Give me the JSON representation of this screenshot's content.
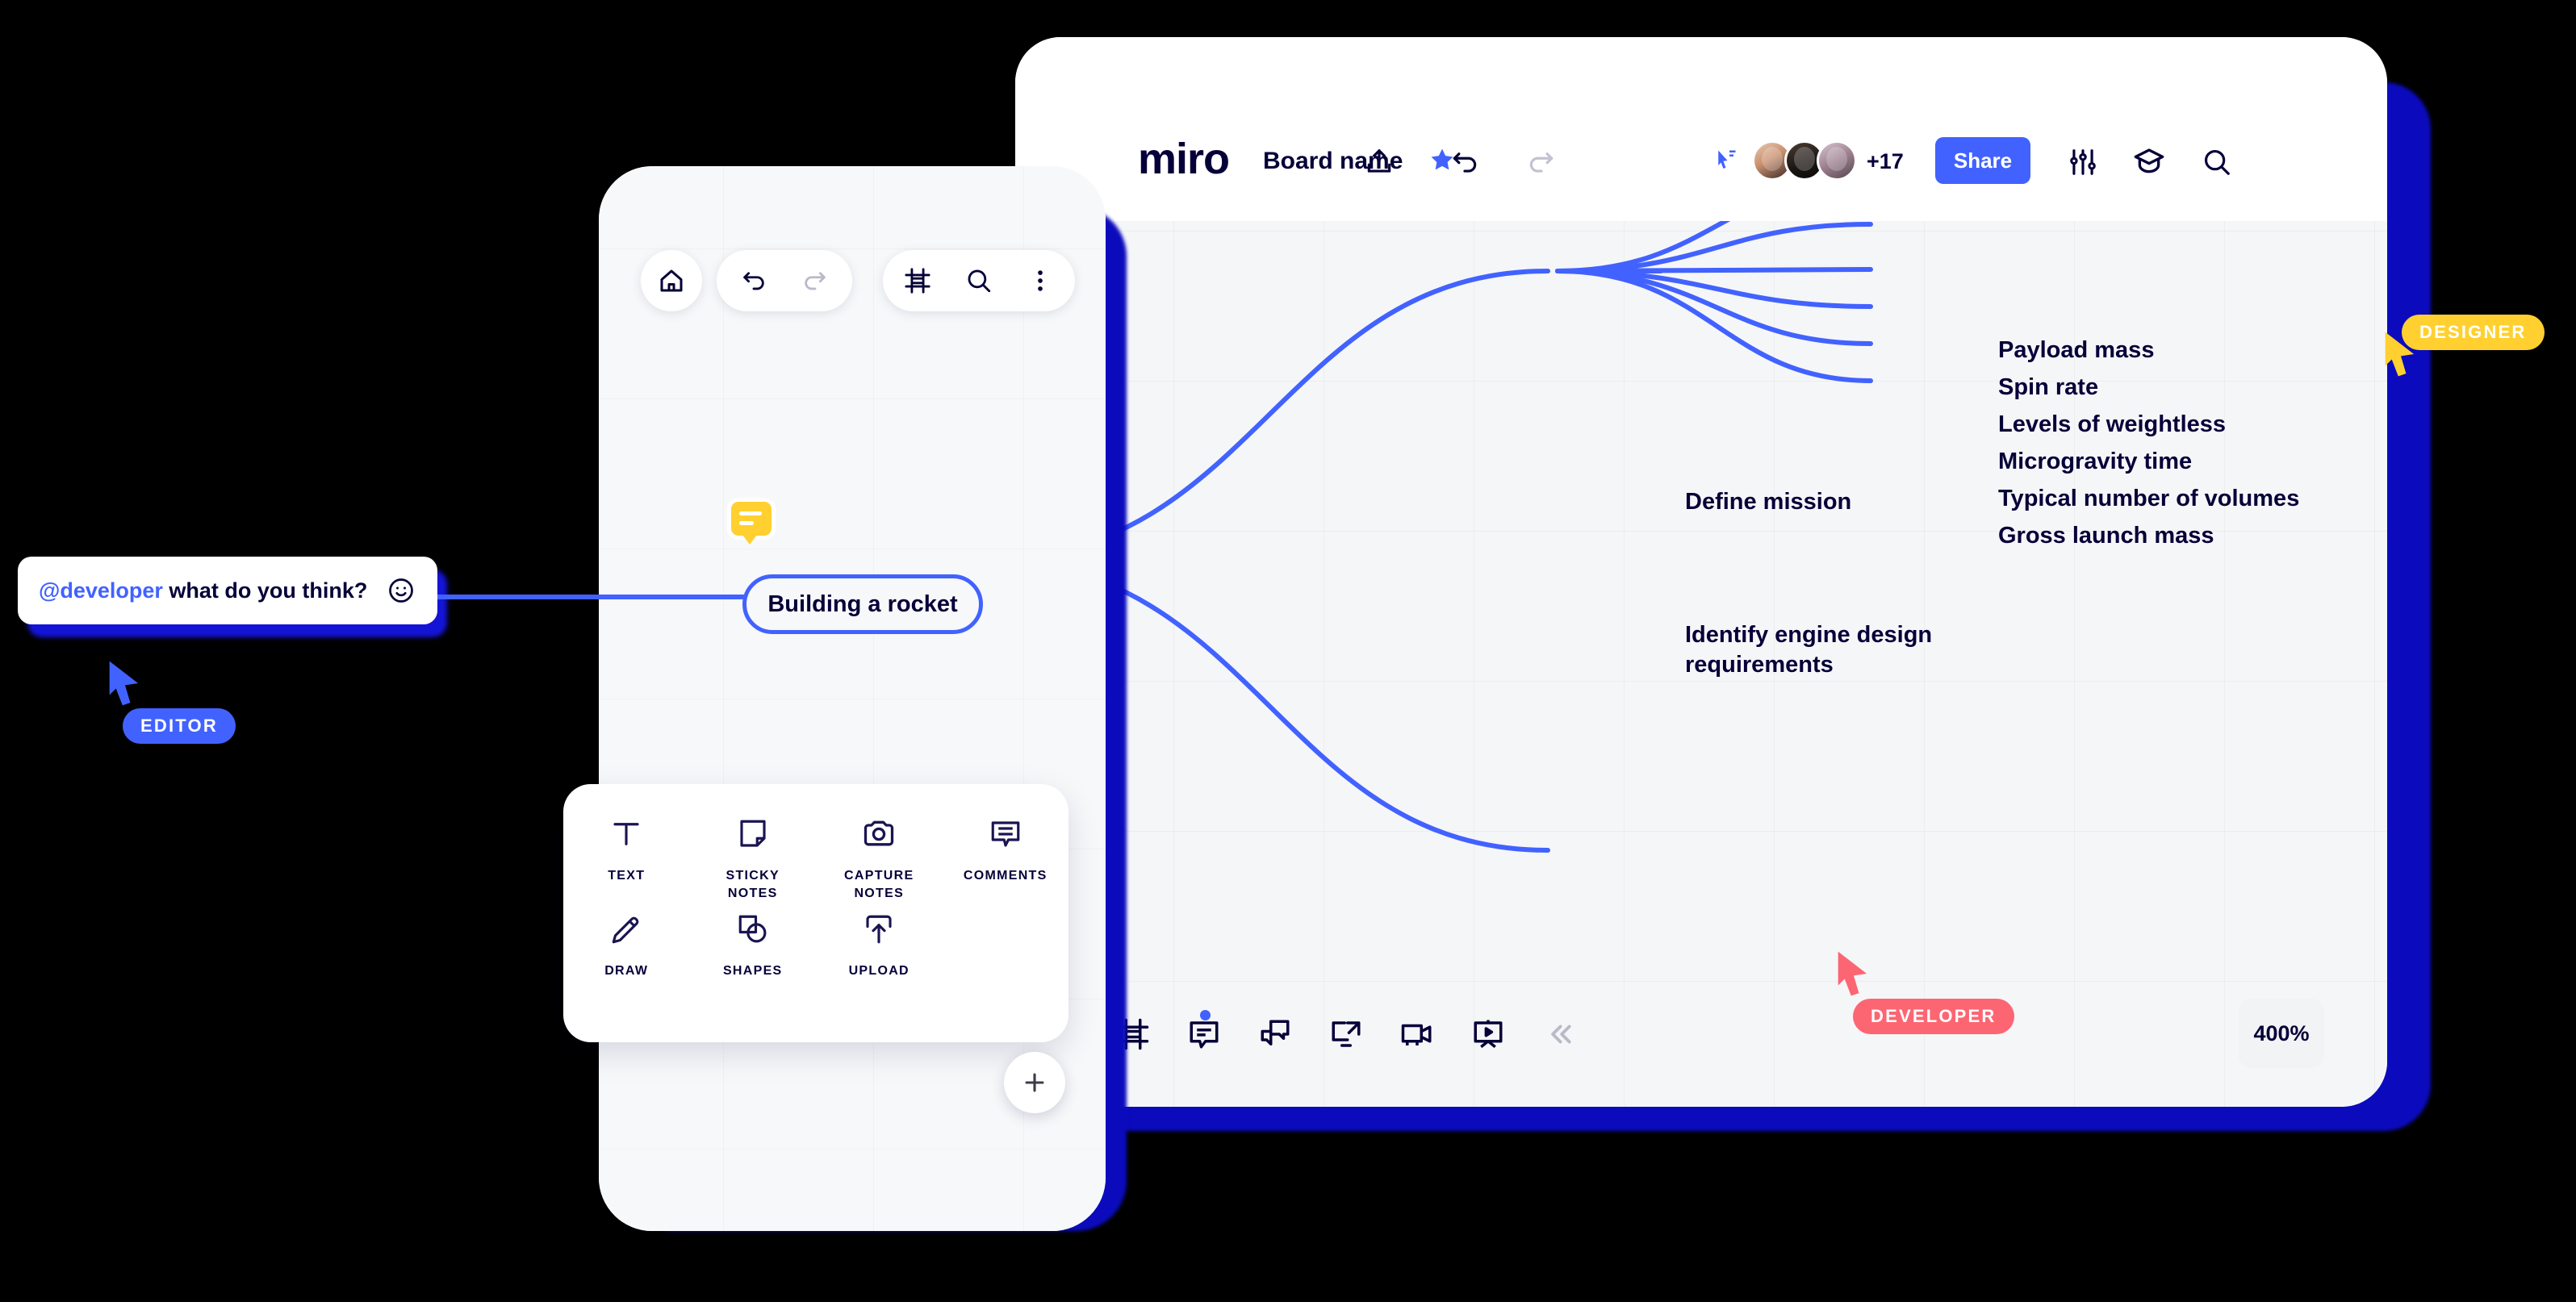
{
  "desktop": {
    "logo": "miro",
    "board_name": "Board name",
    "icons": {
      "star": "star-icon",
      "upload": "upload-icon",
      "undo": "undo-icon",
      "redo": "redo-icon",
      "cursor": "cursor-pointer-icon",
      "settings": "settings-sliders-icon",
      "academy": "graduation-cap-icon",
      "search": "search-icon"
    },
    "collaborators": {
      "extra_count": "+17"
    },
    "share_label": "Share",
    "zoom_level": "400%",
    "bottom_toolbar": [
      {
        "name": "frames-icon",
        "label": "Frames",
        "badge": false
      },
      {
        "name": "comments-icon",
        "label": "Comments",
        "badge": true
      },
      {
        "name": "chat-icon",
        "label": "Chat",
        "badge": false
      },
      {
        "name": "screen-share-icon",
        "label": "Screen share",
        "badge": false
      },
      {
        "name": "video-chat-icon",
        "label": "Video chat",
        "badge": false
      },
      {
        "name": "presentation-icon",
        "label": "Presentation mode",
        "badge": false
      },
      {
        "name": "collapse-icon",
        "label": "Collapse",
        "badge": false
      }
    ]
  },
  "mindmap": {
    "root": "Building a rocket",
    "level1": [
      {
        "label": "Define mission"
      },
      {
        "label": "Identify engine design\nrequirements"
      }
    ],
    "level2": [
      "Payload mass",
      "Spin rate",
      "Levels of weightless",
      "Microgravity time",
      "Typical number of volumes",
      "Gross launch mass"
    ],
    "line_color": "#4262ff"
  },
  "mobile": {
    "toolbar": [
      {
        "name": "home-icon",
        "label": "Home"
      },
      {
        "name": "undo-icon",
        "label": "Undo"
      },
      {
        "name": "redo-icon",
        "label": "Redo"
      },
      {
        "name": "frames-icon",
        "label": "Frames"
      },
      {
        "name": "search-icon",
        "label": "Search"
      },
      {
        "name": "more-menu-icon",
        "label": "More"
      }
    ],
    "tools": [
      {
        "icon": "text-icon",
        "label": "TEXT"
      },
      {
        "icon": "sticky-notes-icon",
        "label": "STICKY\nNOTES"
      },
      {
        "icon": "camera-icon",
        "label": "CAPTURE\nNOTES"
      },
      {
        "icon": "comment-icon",
        "label": "COMMENTS"
      },
      {
        "icon": "pencil-icon",
        "label": "DRAW"
      },
      {
        "icon": "shapes-icon",
        "label": "SHAPES"
      },
      {
        "icon": "upload-icon",
        "label": "UPLOAD"
      }
    ],
    "add_button": "+"
  },
  "comment": {
    "mention": "@developer",
    "text": " what do you think?",
    "emoji": "smiley-icon"
  },
  "cursors": [
    {
      "name": "EDITOR",
      "color": "#4262ff"
    },
    {
      "name": "DEVELOPER",
      "color": "#fc6673"
    },
    {
      "name": "DESIGNER",
      "color": "#ffd02f"
    }
  ]
}
